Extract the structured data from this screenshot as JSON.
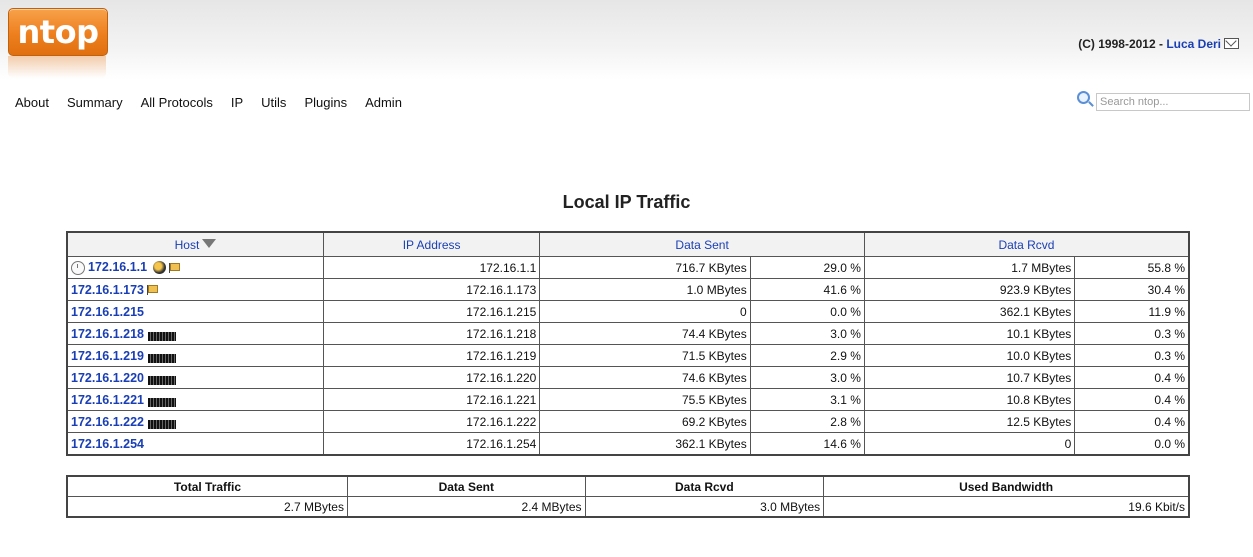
{
  "header": {
    "logo_text": "ntop",
    "copyright": "(C) 1998-2012 - ",
    "author": "Luca Deri"
  },
  "menu": [
    {
      "label": "About"
    },
    {
      "label": "Summary"
    },
    {
      "label": "All Protocols"
    },
    {
      "label": "IP"
    },
    {
      "label": "Utils"
    },
    {
      "label": "Plugins"
    },
    {
      "label": "Admin"
    }
  ],
  "search": {
    "placeholder": "Search ntop..."
  },
  "page_title": "Local IP Traffic",
  "table": {
    "columns": {
      "host": "Host",
      "ip": "IP Address",
      "sent": "Data Sent",
      "rcvd": "Data Rcvd"
    },
    "rows": [
      {
        "host": "172.16.1.1",
        "ip": "172.16.1.1",
        "sent": "716.7 KBytes",
        "sent_pct": "29.0 %",
        "rcvd": "1.7 MBytes",
        "rcvd_pct": "55.8 %"
      },
      {
        "host": "172.16.1.173",
        "ip": "172.16.1.173",
        "sent": "1.0 MBytes",
        "sent_pct": "41.6 %",
        "rcvd": "923.9 KBytes",
        "rcvd_pct": "30.4 %"
      },
      {
        "host": "172.16.1.215",
        "ip": "172.16.1.215",
        "sent": "0",
        "sent_pct": "0.0 %",
        "rcvd": "362.1 KBytes",
        "rcvd_pct": "11.9 %"
      },
      {
        "host": "172.16.1.218",
        "ip": "172.16.1.218",
        "sent": "74.4 KBytes",
        "sent_pct": "3.0 %",
        "rcvd": "10.1 KBytes",
        "rcvd_pct": "0.3 %"
      },
      {
        "host": "172.16.1.219",
        "ip": "172.16.1.219",
        "sent": "71.5 KBytes",
        "sent_pct": "2.9 %",
        "rcvd": "10.0 KBytes",
        "rcvd_pct": "0.3 %"
      },
      {
        "host": "172.16.1.220",
        "ip": "172.16.1.220",
        "sent": "74.6 KBytes",
        "sent_pct": "3.0 %",
        "rcvd": "10.7 KBytes",
        "rcvd_pct": "0.4 %"
      },
      {
        "host": "172.16.1.221",
        "ip": "172.16.1.221",
        "sent": "75.5 KBytes",
        "sent_pct": "3.1 %",
        "rcvd": "10.8 KBytes",
        "rcvd_pct": "0.4 %"
      },
      {
        "host": "172.16.1.222",
        "ip": "172.16.1.222",
        "sent": "69.2 KBytes",
        "sent_pct": "2.8 %",
        "rcvd": "12.5 KBytes",
        "rcvd_pct": "0.4 %"
      },
      {
        "host": "172.16.1.254",
        "ip": "172.16.1.254",
        "sent": "362.1 KBytes",
        "sent_pct": "14.6 %",
        "rcvd": "0",
        "rcvd_pct": "0.0 %"
      }
    ]
  },
  "summary": {
    "headers": {
      "total": "Total Traffic",
      "sent": "Data Sent",
      "rcvd": "Data Rcvd",
      "bandwidth": "Used Bandwidth"
    },
    "values": {
      "total": "2.7 MBytes",
      "sent": "2.4 MBytes",
      "rcvd": "3.0 MBytes",
      "bandwidth": "19.6 Kbit/s"
    }
  },
  "colors": {
    "link": "#1a3fb5",
    "logo": "#ee7f1f"
  }
}
